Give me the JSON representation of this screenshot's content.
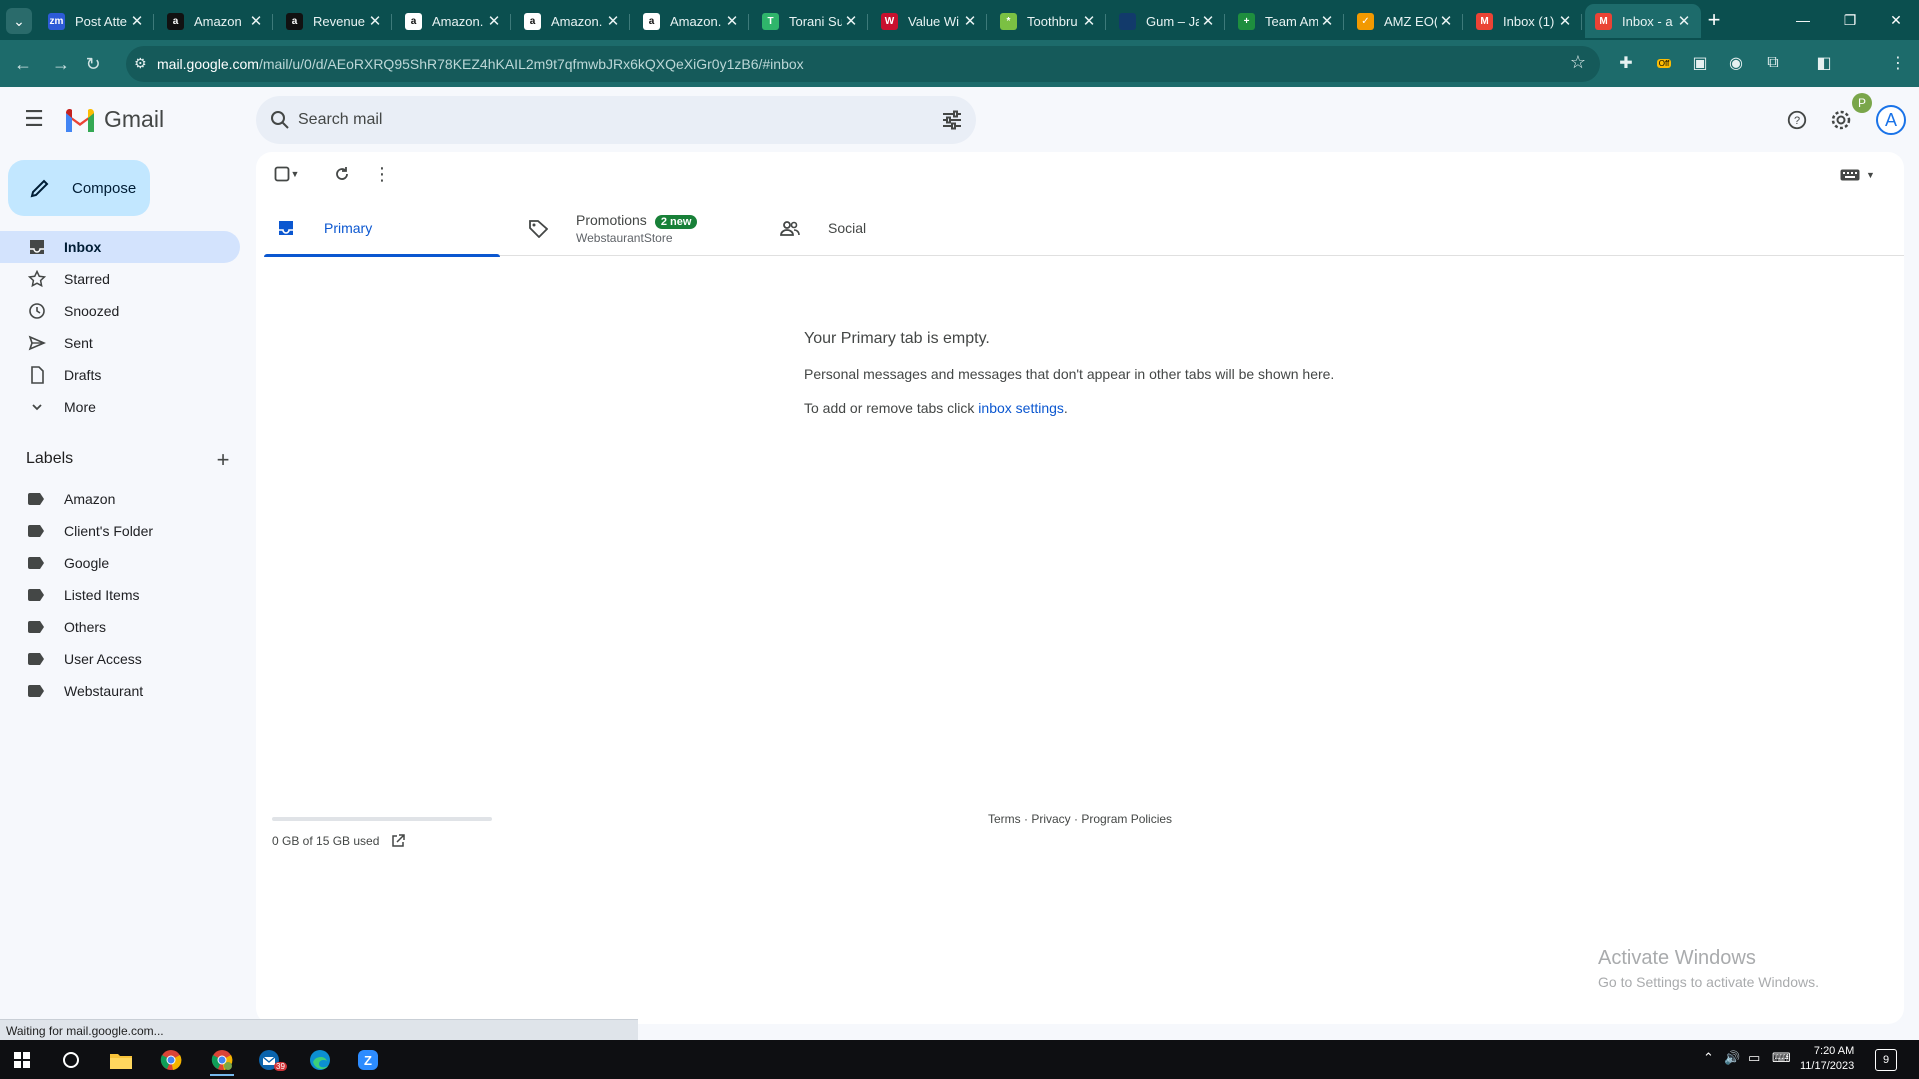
{
  "browser": {
    "tabs": [
      {
        "title": "Post Atte",
        "favicon": "zm",
        "color": "#2d5bd7"
      },
      {
        "title": "Amazon",
        "favicon": "a",
        "color": "#111111"
      },
      {
        "title": "Revenue",
        "favicon": "a",
        "color": "#111111"
      },
      {
        "title": "Amazon.",
        "favicon": "a",
        "color": "#ffffff"
      },
      {
        "title": "Amazon.",
        "favicon": "a",
        "color": "#ffffff"
      },
      {
        "title": "Amazon.",
        "favicon": "a",
        "color": "#ffffff"
      },
      {
        "title": "Torani Su",
        "favicon": "T",
        "color": "#2fb56b"
      },
      {
        "title": "Value Wi",
        "favicon": "W",
        "color": "#c8102e"
      },
      {
        "title": "Toothbru",
        "favicon": "*",
        "color": "#7bc043"
      },
      {
        "title": "Gum – Ja",
        "favicon": "",
        "color": "#123a6b"
      },
      {
        "title": "Team Am",
        "favicon": "+",
        "color": "#1e8e3e"
      },
      {
        "title": "AMZ EO(",
        "favicon": "✓",
        "color": "#f29900"
      },
      {
        "title": "Inbox (1)",
        "favicon": "M",
        "color": "#ea4335"
      },
      {
        "title": "Inbox - a",
        "favicon": "M",
        "color": "#ea4335",
        "active": true
      }
    ],
    "url_host": "mail.google.com",
    "url_path": "/mail/u/0/d/AEoRXRQ95ShR78KEZ4hKAIL2m9t7qfmwbJRx6kQXQeXiGr0y1zB6/#inbox",
    "extension_badge": "Off",
    "profile_initial": "P"
  },
  "gmail": {
    "logo_text": "Gmail",
    "search_placeholder": "Search mail",
    "account_initial": "A",
    "compose_label": "Compose",
    "nav": [
      {
        "label": "Inbox",
        "icon": "inbox-icon",
        "active": true
      },
      {
        "label": "Starred",
        "icon": "star-icon"
      },
      {
        "label": "Snoozed",
        "icon": "clock-icon"
      },
      {
        "label": "Sent",
        "icon": "send-icon"
      },
      {
        "label": "Drafts",
        "icon": "draft-icon"
      },
      {
        "label": "More",
        "icon": "chevron-down-icon"
      }
    ],
    "labels_heading": "Labels",
    "labels": [
      "Amazon",
      "Client's Folder",
      "Google",
      "Listed Items",
      "Others",
      "User Access",
      "Webstaurant"
    ],
    "tabs": {
      "primary": "Primary",
      "promotions": "Promotions",
      "promotions_badge": "2 new",
      "promotions_sub": "WebstaurantStore",
      "social": "Social"
    },
    "empty": {
      "title": "Your Primary tab is empty.",
      "line1": "Personal messages and messages that don't appear in other tabs will be shown here.",
      "line2_prefix": "To add or remove tabs click ",
      "line2_link": "inbox settings",
      "line2_suffix": "."
    },
    "storage": {
      "text": "0 GB of 15 GB used",
      "fraction": 0.0
    },
    "footer": {
      "terms": "Terms",
      "sep1": " · ",
      "privacy": "Privacy",
      "sep2": " · ",
      "policies": "Program Policies"
    }
  },
  "watermark": {
    "line1": "Activate Windows",
    "line2": "Go to Settings to activate Windows."
  },
  "status_bar": "Waiting for mail.google.com...",
  "taskbar": {
    "time": "7:20 AM",
    "date": "11/17/2023",
    "notification_count": "9",
    "mail_badge": "39"
  },
  "colors": {
    "accent": "#0b57d0",
    "compose_bg": "#c2e7ff",
    "active_nav": "#d3e3fd",
    "chrome_theme": "#1d6b6b"
  }
}
